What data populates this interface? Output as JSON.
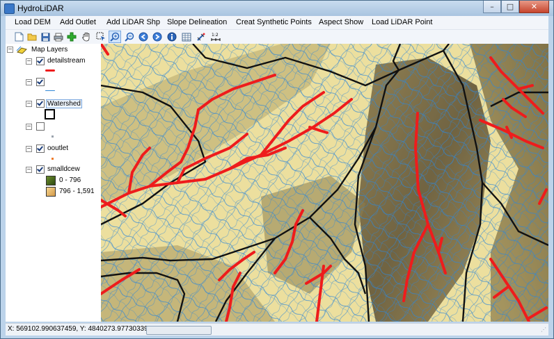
{
  "window": {
    "title": "HydroLiDAR",
    "controls": {
      "minimize": "–",
      "maximize": "□",
      "close": "✕"
    }
  },
  "menu": [
    "Load DEM",
    "Add Outlet",
    "Add LiDAR Shp",
    "Slope Delineation",
    "Creat Synthetic Points",
    "Aspect Show",
    "Load LiDAR Point"
  ],
  "toolbar": [
    "new-document-icon",
    "open-folder-icon",
    "save-icon",
    "print-icon",
    "add-data-icon",
    "pan-hand-icon",
    "select-features-icon",
    "zoom-in-icon",
    "zoom-out-icon",
    "back-extent-icon",
    "forward-extent-icon",
    "identify-icon",
    "attribute-table-icon",
    "measure-icon",
    "scale-icon"
  ],
  "toc": {
    "root": "Map Layers",
    "layers": [
      {
        "name": "detailstream",
        "checked": true,
        "symbol": "line",
        "color": "#ee1c1c"
      },
      {
        "name": "",
        "checked": true,
        "symbol": "line",
        "color": "#2f86d6"
      },
      {
        "name": "Watershed",
        "checked": true,
        "symbol": "polygon",
        "color": "#000000"
      },
      {
        "name": "",
        "checked": false,
        "symbol": "point",
        "color": "#9aa3ad"
      },
      {
        "name": "ooutlet",
        "checked": true,
        "symbol": "point",
        "color": "#f07b2a"
      },
      {
        "name": "smalldcew",
        "checked": true,
        "symbol": "raster",
        "classes": [
          {
            "label": "0 - 796",
            "color": "#4a6f1c"
          },
          {
            "label": "796 - 1,591",
            "color": "#e8b768"
          }
        ]
      }
    ]
  },
  "status": {
    "coordinates": "X: 569102.990637459, Y: 4840273.97730339"
  },
  "colors": {
    "stream": "#ee1c1c",
    "drainage": "#2f86d6",
    "watershed": "#111111",
    "dem_light": "#ecdf9e",
    "dem_dark": "#6e6344"
  }
}
